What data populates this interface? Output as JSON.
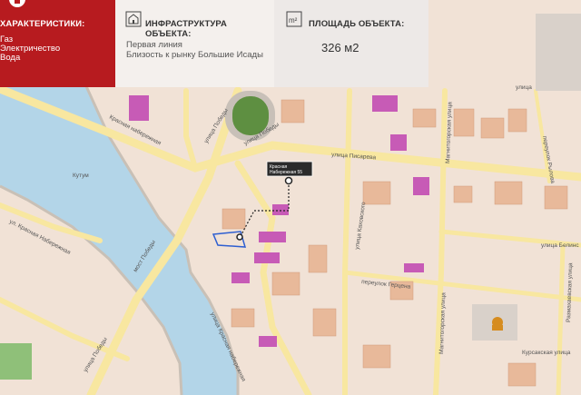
{
  "panel_features": {
    "title": "ХАРАКТЕРИСТИКИ:",
    "items": [
      "Газ",
      "Электричество",
      "Вода"
    ],
    "icon": "logo-icon"
  },
  "panel_infra": {
    "title": "ИНФРАСТРУКТУРА ОБЪЕКТА:",
    "icon": "building-icon",
    "items": [
      "Первая линия",
      "Близость к рынку Большие Исады"
    ]
  },
  "panel_area": {
    "title": "ПЛОЩАДЬ ОБЪЕКТА:",
    "icon": "area-m2-icon",
    "icon_text": "m²",
    "value": "326 м2"
  },
  "map": {
    "river_label": "Кутум",
    "streets": {
      "krasnaya_emb_upper": "Красная набережная",
      "krasnaya_emb_lower": "ул. Красная Набережная",
      "pobedy_upper": "улица Победы",
      "pobedy_lower": "улица Победы",
      "most_pobedy": "мост Победы",
      "ulitsa_pobedy_left": "улица Победы",
      "pisareva": "улица Писарева",
      "kakhovskogo": "улица Каховского",
      "magnitogorskaya_upper": "Магнитогорская улица",
      "magnitogorskaya_lower": "Магнитогорская улица",
      "rylova": "переулок Рылова",
      "belinsk": "улица Белинс",
      "gerzena": "переулок Герцена",
      "kursakskaya": "Курсакская улица",
      "razmakhaevskaya": "Размахаевская улица",
      "krasnaya_emb_diag": "улица Красная набережная",
      "ulitsa_top": "улица"
    },
    "marker_caption_line1": "Красная",
    "marker_caption_line2": "Набережная 55",
    "colors": {
      "water": "#b3d5e8",
      "land": "#f1e2d6",
      "road": "#f8e7a0",
      "parcel": "#e8b99a",
      "magenta": "#c75bb6",
      "accent": "#b71b1f",
      "field": "#5e8f41"
    }
  }
}
